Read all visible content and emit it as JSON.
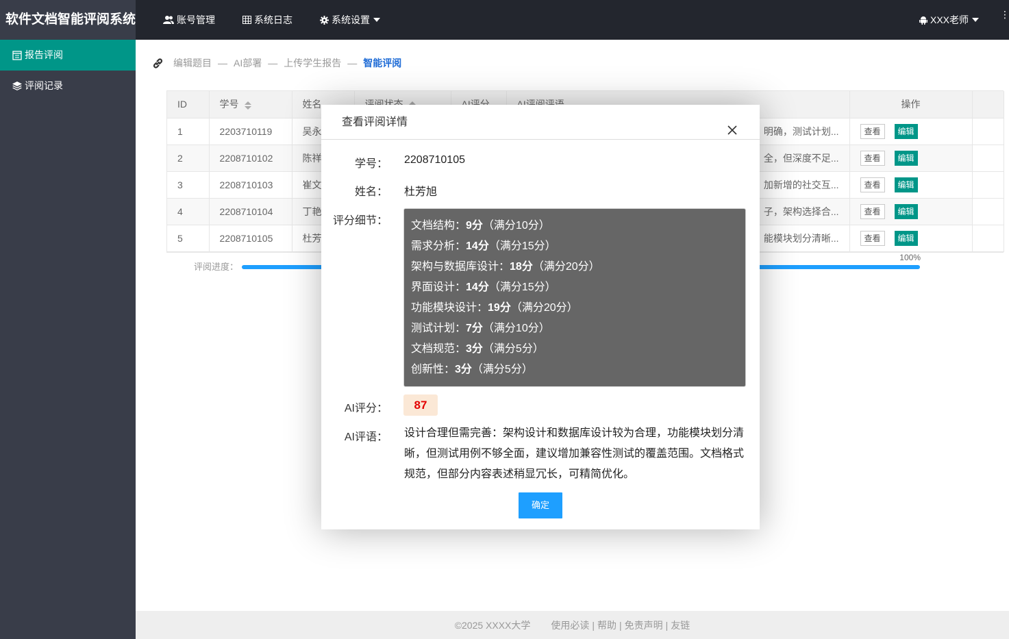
{
  "app": {
    "title": "软件文档智能评阅系统"
  },
  "top_nav": {
    "items": [
      {
        "label": "账号管理",
        "icon": "users-icon"
      },
      {
        "label": "系统日志",
        "icon": "grid-icon"
      },
      {
        "label": "系统设置",
        "icon": "gear-icon"
      }
    ],
    "user": "XXX老师"
  },
  "sidebar": {
    "items": [
      {
        "label": "报告评阅",
        "icon": "report-icon",
        "active": true
      },
      {
        "label": "评阅记录",
        "icon": "layers-icon",
        "active": false
      }
    ]
  },
  "breadcrumb": [
    "编辑题目",
    "AI部署",
    "上传学生报告",
    "智能评阅"
  ],
  "table": {
    "headers": [
      "ID",
      "学号",
      "姓名",
      "评阅状态",
      "AI评分",
      "AI评阅评语",
      "操作"
    ],
    "view_label": "查看",
    "edit_label": "编辑",
    "rows": [
      {
        "id": "1",
        "student_id": "2203710119",
        "name": "吴永",
        "comment_tail": "明确，测试计划..."
      },
      {
        "id": "2",
        "student_id": "2208710102",
        "name": "陈祥",
        "comment_tail": "全，但深度不足..."
      },
      {
        "id": "3",
        "student_id": "2208710103",
        "name": "崔文",
        "comment_tail": "加新增的社交互..."
      },
      {
        "id": "4",
        "student_id": "2208710104",
        "name": "丁艳",
        "comment_tail": "子，架构选择合..."
      },
      {
        "id": "5",
        "student_id": "2208710105",
        "name": "杜芳",
        "comment_tail": "能模块划分清晰..."
      }
    ]
  },
  "progress": {
    "label": "评阅进度：",
    "value": 1.0,
    "text": "100%"
  },
  "footer": {
    "copyright": "©2025 XXXX大学",
    "links": [
      "使用必读",
      "帮助",
      "免责声明",
      "友链"
    ]
  },
  "modal": {
    "title": "查看评阅详情",
    "student_id_label": "学号：",
    "student_id": "2208710105",
    "name_label": "姓名：",
    "name": "杜芳旭",
    "detail_label": "评分细节：",
    "details": [
      {
        "item": "文档结构：",
        "score": "9分",
        "full": "（满分10分）"
      },
      {
        "item": "需求分析：",
        "score": "14分",
        "full": "（满分15分）"
      },
      {
        "item": "架构与数据库设计：",
        "score": "18分",
        "full": "（满分20分）"
      },
      {
        "item": "界面设计：",
        "score": "14分",
        "full": "（满分15分）"
      },
      {
        "item": "功能模块设计：",
        "score": "19分",
        "full": "（满分20分）"
      },
      {
        "item": "测试计划：",
        "score": "7分",
        "full": "（满分10分）"
      },
      {
        "item": "文档规范：",
        "score": "3分",
        "full": "（满分5分）"
      },
      {
        "item": "创新性：",
        "score": "3分",
        "full": "（满分5分）"
      }
    ],
    "ai_score_label": "AI评分：",
    "ai_score": "87",
    "ai_comment_label": "AI评语：",
    "ai_comment": "设计合理但需完善：架构设计和数据库设计较为合理，功能模块划分清晰，但测试用例不够全面，建议增加兼容性测试的覆盖范围。文档格式规范，但部分内容表述稍显冗长，可精简优化。",
    "confirm_label": "确定"
  },
  "colors": {
    "header_bg": "#23262e",
    "sidebar_bg": "#393d49",
    "active_green": "#009688",
    "accent_blue": "#1e9fff",
    "score_red": "#e30000"
  }
}
